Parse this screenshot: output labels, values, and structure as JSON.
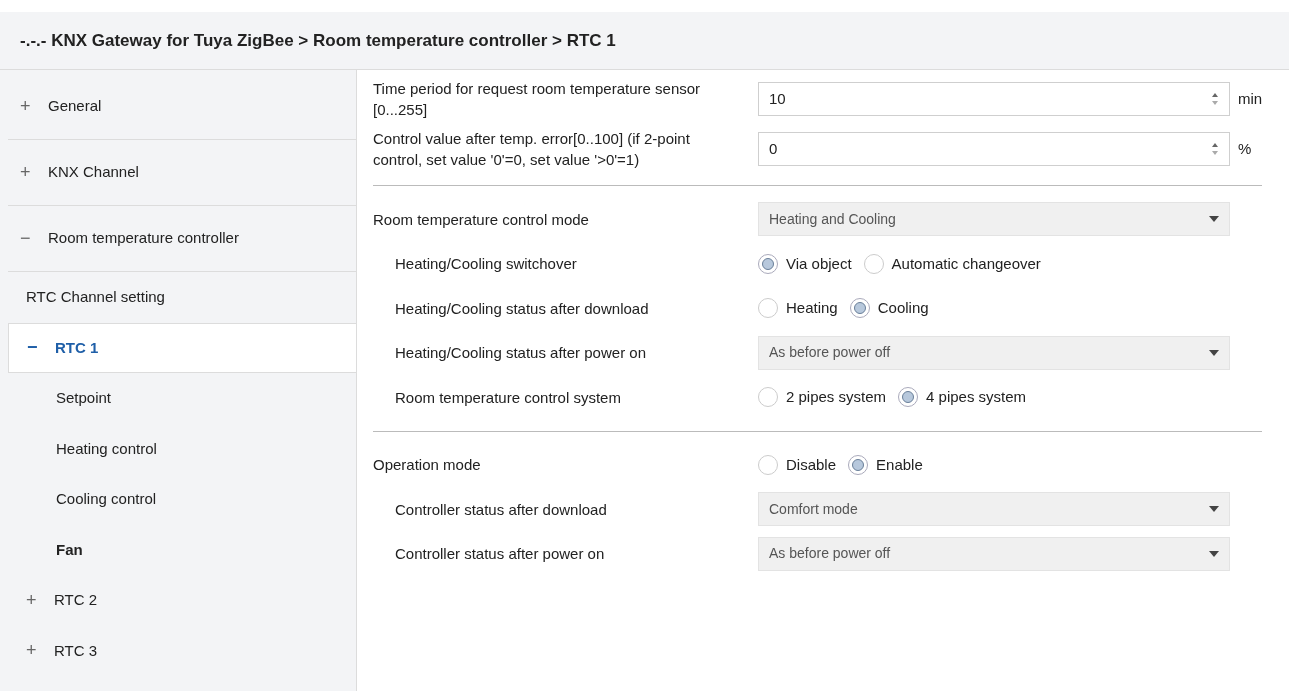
{
  "title": "-.-.- KNX Gateway for Tuya ZigBee > Room temperature controller > RTC 1",
  "sidebar": {
    "items": [
      {
        "sign": "+",
        "label": "General",
        "selected": false,
        "bold": false
      },
      {
        "sign": "+",
        "label": "KNX Channel",
        "selected": false,
        "bold": false
      },
      {
        "sign": "−",
        "label": "Room temperature controller",
        "selected": false,
        "bold": false,
        "children": [
          {
            "label": "RTC Channel setting",
            "selected": false,
            "bold": false
          },
          {
            "sign": "−",
            "label": "RTC 1",
            "selected": true,
            "bold": false,
            "children": [
              {
                "label": "Setpoint",
                "selected": false,
                "bold": false
              },
              {
                "label": "Heating control",
                "selected": false,
                "bold": false
              },
              {
                "label": "Cooling control",
                "selected": false,
                "bold": false
              },
              {
                "label": "Fan",
                "selected": false,
                "bold": true
              }
            ]
          },
          {
            "sign": "+",
            "label": "RTC 2",
            "selected": false,
            "bold": false
          },
          {
            "sign": "+",
            "label": "RTC 3",
            "selected": false,
            "bold": false
          }
        ]
      }
    ]
  },
  "params": [
    {
      "kind": "number",
      "label": "Time period for request room temperature sensor [0...255]",
      "value": "10",
      "unit": "min"
    },
    {
      "kind": "number",
      "label": "Control value after temp. error[0..100] (if 2-point control, set value '0'=0, set value '>0'=1)",
      "value": "0",
      "unit": "%"
    },
    {
      "kind": "separator"
    },
    {
      "kind": "dropdown",
      "label": "Room  temperature control mode",
      "value": "Heating and Cooling",
      "children": [
        {
          "kind": "radio",
          "label": "Heating/Cooling switchover",
          "options": [
            {
              "label": "Via object",
              "selected": true
            },
            {
              "label": "Automatic changeover",
              "selected": false
            }
          ]
        },
        {
          "kind": "radio",
          "label": "Heating/Cooling status after download",
          "options": [
            {
              "label": "Heating",
              "selected": false
            },
            {
              "label": "Cooling",
              "selected": true
            }
          ]
        },
        {
          "kind": "dropdown",
          "label": "Heating/Cooling status after power on",
          "value": "As before power off"
        },
        {
          "kind": "radio",
          "label": "Room temperature control system",
          "options": [
            {
              "label": "2 pipes system",
              "selected": false
            },
            {
              "label": "4 pipes system",
              "selected": true
            }
          ]
        }
      ]
    },
    {
      "kind": "separator"
    },
    {
      "kind": "radio",
      "label": "Operation mode",
      "options": [
        {
          "label": "Disable",
          "selected": false
        },
        {
          "label": "Enable",
          "selected": true
        }
      ],
      "children": [
        {
          "kind": "dropdown",
          "label": "Controller status after download",
          "value": "Comfort mode"
        },
        {
          "kind": "dropdown",
          "label": "Controller status after power on",
          "value": "As before power off"
        }
      ]
    }
  ]
}
